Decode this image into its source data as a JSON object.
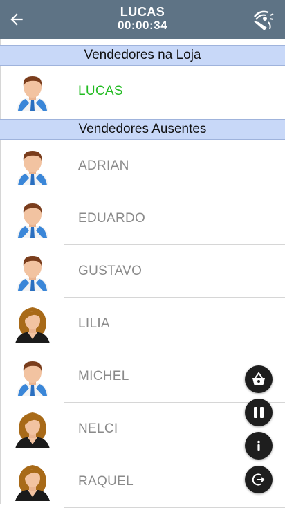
{
  "header": {
    "title": "LUCAS",
    "timer": "00:00:34",
    "back_icon": "arrow-left-icon",
    "action_icon": "sync-icon"
  },
  "sections": {
    "present_label": "Vendedores na Loja",
    "absent_label": "Vendedores Ausentes"
  },
  "present_sellers": [
    {
      "name": "LUCAS",
      "avatar": "male"
    }
  ],
  "absent_sellers": [
    {
      "name": "ADRIAN",
      "avatar": "male"
    },
    {
      "name": "EDUARDO",
      "avatar": "male"
    },
    {
      "name": "GUSTAVO",
      "avatar": "male"
    },
    {
      "name": "LILIA",
      "avatar": "female"
    },
    {
      "name": "MICHEL",
      "avatar": "male"
    },
    {
      "name": "NELCI",
      "avatar": "female"
    },
    {
      "name": "RAQUEL",
      "avatar": "female"
    }
  ],
  "fabs": [
    "basket-icon",
    "pause-icon",
    "info-icon",
    "logout-icon"
  ],
  "colors": {
    "header_bg": "#5e7385",
    "section_bg": "#c8d8f8",
    "present_name": "#22bb22",
    "absent_name": "#8a8a8a",
    "fab_bg": "#1e1e1e"
  }
}
